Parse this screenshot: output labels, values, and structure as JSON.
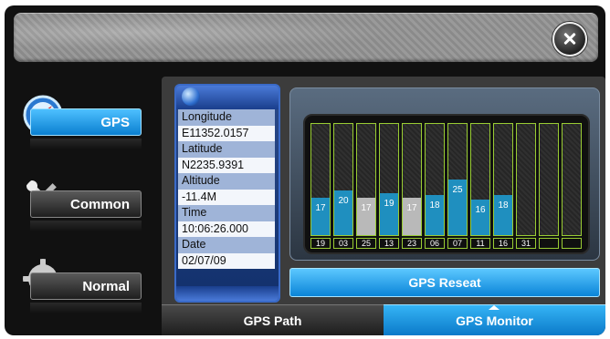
{
  "close_icon": "close-icon",
  "sidebar": {
    "items": [
      {
        "label": "GPS",
        "icon": "compass-icon",
        "active": true
      },
      {
        "label": "Common",
        "icon": "tools-icon",
        "active": false
      },
      {
        "label": "Normal",
        "icon": "gear-icon",
        "active": false
      }
    ]
  },
  "info": {
    "longitude_label": "Longitude",
    "longitude_value": "E11352.0157",
    "latitude_label": "Latitude",
    "latitude_value": "N2235.9391",
    "altitude_label": "Altitude",
    "altitude_value": "-11.4M",
    "time_label": "Time",
    "time_value": "10:06:26.000",
    "date_label": "Date",
    "date_value": "02/07/09"
  },
  "satellites": [
    {
      "prn": "19",
      "snr": 17,
      "used": true
    },
    {
      "prn": "03",
      "snr": 20,
      "used": true
    },
    {
      "prn": "25",
      "snr": 17,
      "used": false
    },
    {
      "prn": "13",
      "snr": 19,
      "used": true
    },
    {
      "prn": "23",
      "snr": 17,
      "used": false
    },
    {
      "prn": "06",
      "snr": 18,
      "used": true
    },
    {
      "prn": "07",
      "snr": 25,
      "used": true
    },
    {
      "prn": "11",
      "snr": 16,
      "used": true
    },
    {
      "prn": "16",
      "snr": 18,
      "used": true
    },
    {
      "prn": "31",
      "snr": null,
      "used": false
    },
    {
      "prn": "",
      "snr": null,
      "used": false
    },
    {
      "prn": "",
      "snr": null,
      "used": false
    }
  ],
  "colors": {
    "used": "#1f8fbf",
    "unused": "#b9b9b9",
    "accent": "#1a9ae8"
  },
  "reset_label": "GPS Reseat",
  "tabs": {
    "path_label": "GPS Path",
    "monitor_label": "GPS Monitor",
    "active": "monitor"
  }
}
